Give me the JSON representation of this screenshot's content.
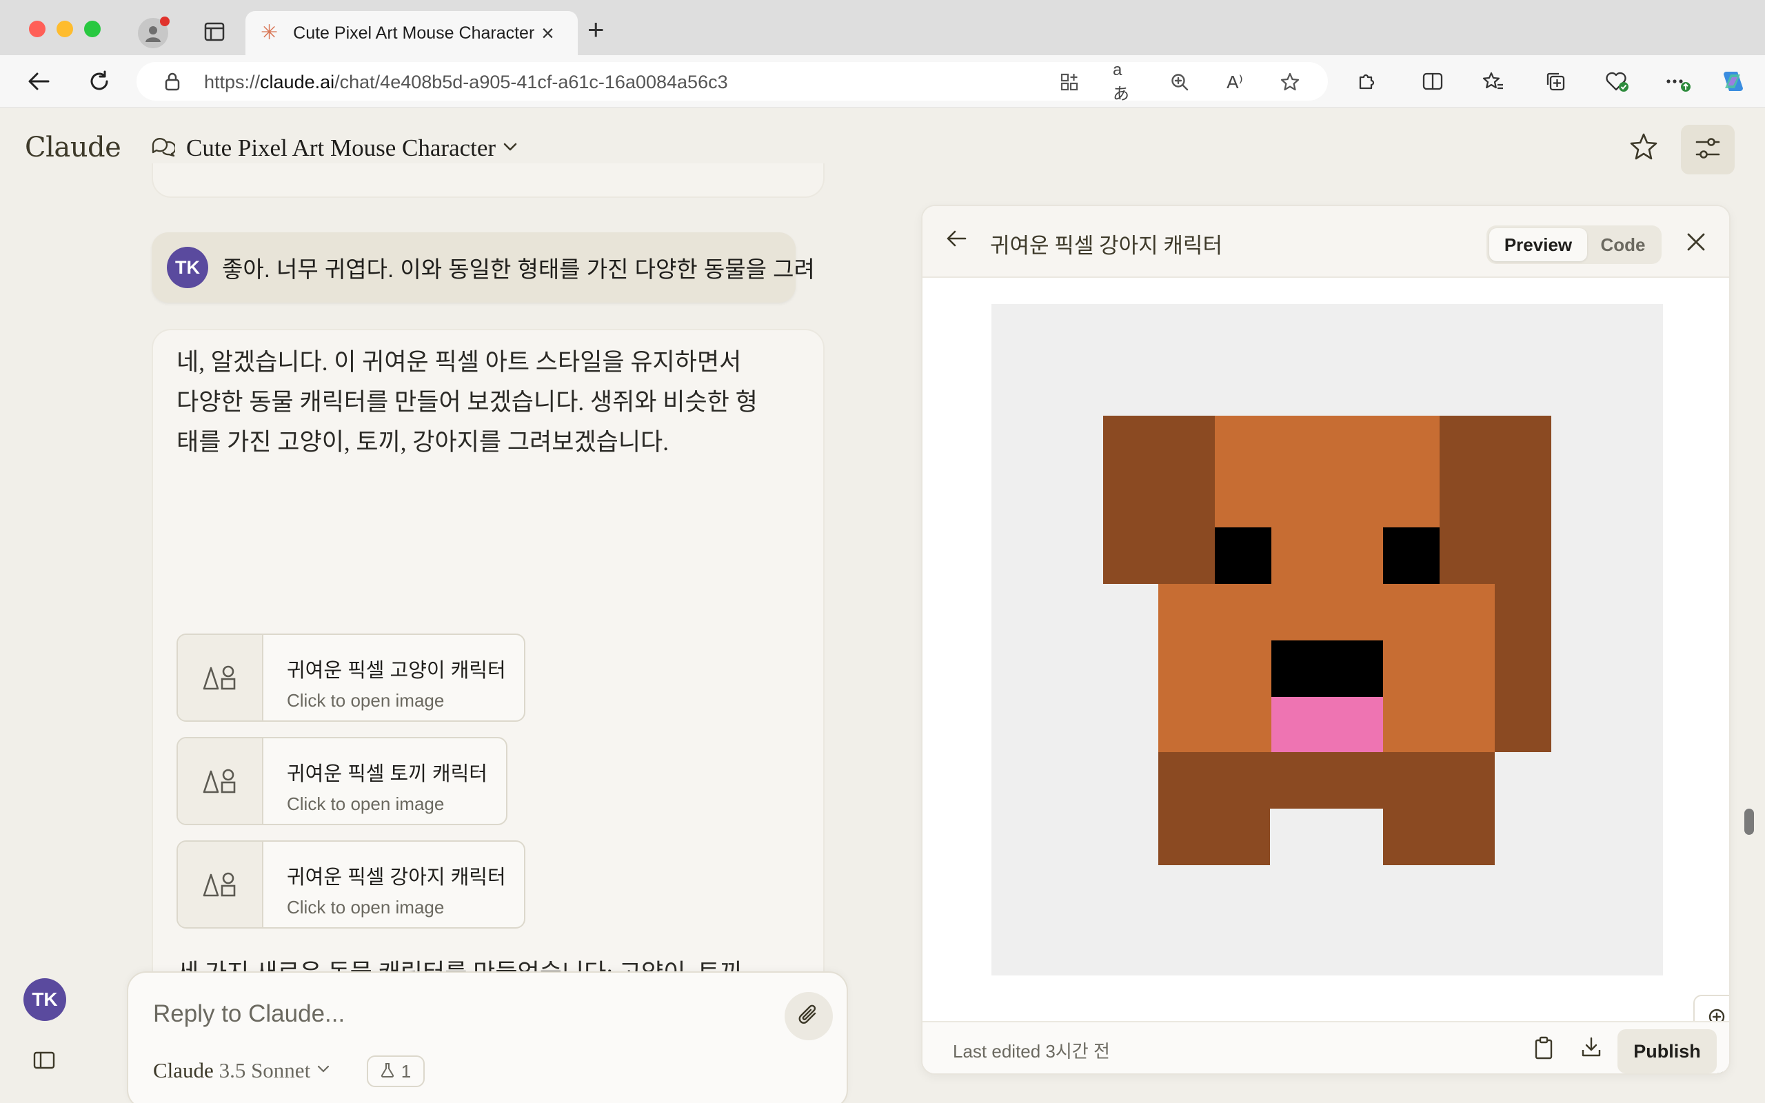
{
  "browser": {
    "tab_title": "Cute Pixel Art Mouse Character",
    "tab_favicon": "✳",
    "url_prefix": "https://",
    "url_domain": "claude.ai",
    "url_path": "/chat/4e408b5d-a905-41cf-a61c-16a0084a56c3"
  },
  "app": {
    "logo": "Claude",
    "chat_title": "Cute Pixel Art Mouse Character"
  },
  "chat": {
    "user_initials": "TK",
    "user_message": "좋아. 너무 귀엽다. 이와 동일한 형태를 가진 다양한 동물을 그려",
    "assistant_intro": "네, 알겠습니다. 이 귀여운 픽셀 아트 스타일을 유지하면서 다양한 동물 캐릭터를 만들어 보겠습니다. 생쥐와 비슷한 형태를 가진 고양이, 토끼, 강아지를 그려보겠습니다.",
    "artifacts": [
      {
        "title": "귀여운 픽셀 고양이 캐릭터",
        "subtitle": "Click to open image"
      },
      {
        "title": "귀여운 픽셀 토끼 캐릭터",
        "subtitle": "Click to open image"
      },
      {
        "title": "귀여운 픽셀 강아지 캐릭터",
        "subtitle": "Click to open image"
      }
    ],
    "assistant_outro": "세 가지 새로운 동물 캐릭터를 만들었습니다: 고양이, 토끼, 강아지입니다. 각 캐릭터는 원래의 생쥐 캐릭터와 비슷한 스타일을 유지하면서 각 동물의 특징을 반영했습니다."
  },
  "composer": {
    "placeholder": "Reply to Claude...",
    "model_brand": "Claude",
    "model_version": "3.5 Sonnet",
    "badge_count": "1"
  },
  "panel": {
    "title": "귀여운 픽셀 강아지 캐릭터",
    "tab_preview": "Preview",
    "tab_code": "Code",
    "last_edited": "Last edited 3시간 전",
    "publish_label": "Publish"
  },
  "colors": {
    "dark_brown": "#8b4a22",
    "orange_brown": "#c76d33",
    "black": "#000000",
    "pink": "#ee74b2",
    "canvas_bg": "#efefef",
    "accent_avatar": "#5a4a9e"
  }
}
